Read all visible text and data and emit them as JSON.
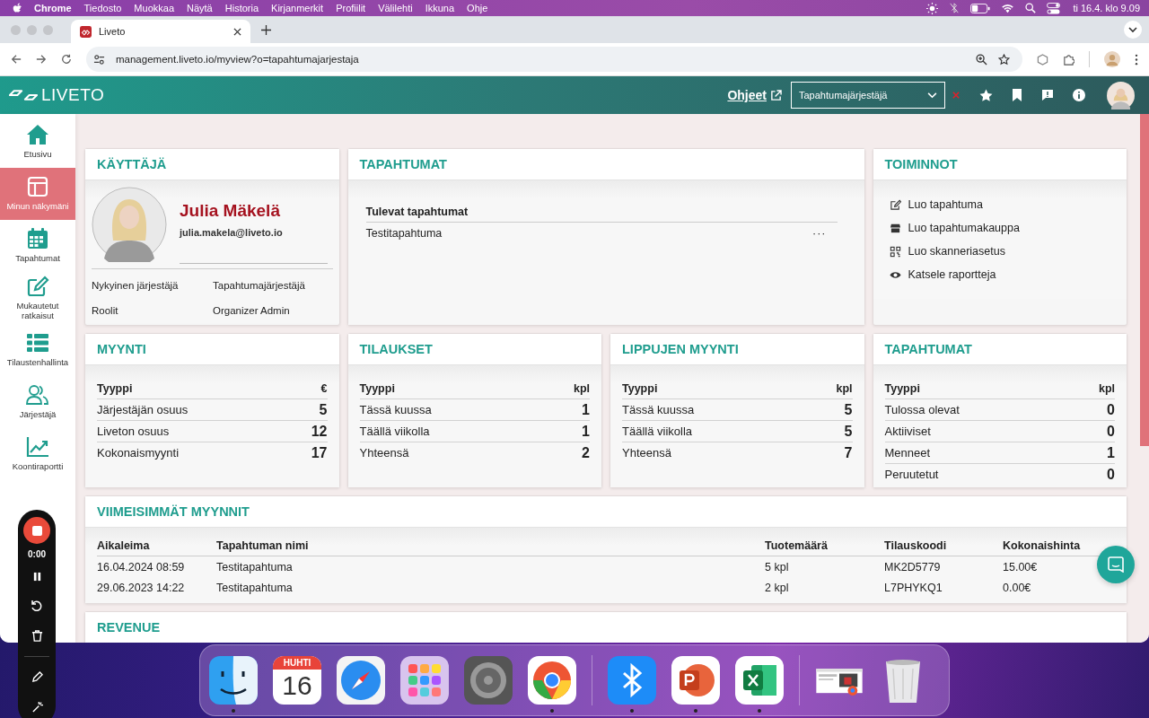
{
  "menubar": {
    "app": "Chrome",
    "menus": [
      "Tiedosto",
      "Muokkaa",
      "Näytä",
      "Historia",
      "Kirjanmerkit",
      "Profiilit",
      "Välilehti",
      "Ikkuna",
      "Ohje"
    ],
    "clock": "ti 16.4. klo 9.09"
  },
  "browser": {
    "tab_title": "Liveto",
    "url": "management.liveto.io/myview?o=tapahtumajarjestaja"
  },
  "header": {
    "logo": "LIVETO",
    "help_link": "Ohjeet",
    "organizer_select": "Tapahtumajärjestäjä"
  },
  "sidebar": {
    "items": [
      {
        "label": "Etusivu",
        "kind": "home",
        "selected": false
      },
      {
        "label": "Minun näkymäni",
        "kind": "layout",
        "selected": true
      },
      {
        "label": "Tapahtumat",
        "kind": "calendar",
        "selected": false
      },
      {
        "label": "Mukautetut ratkaisut",
        "kind": "edit",
        "selected": false
      },
      {
        "label": "Tilaustenhallinta",
        "kind": "list",
        "selected": false
      },
      {
        "label": "Järjestäjä",
        "kind": "users",
        "selected": false
      },
      {
        "label": "Koontiraportti",
        "kind": "chart",
        "selected": false
      }
    ]
  },
  "user_card": {
    "title": "KÄYTTÄJÄ",
    "name": "Julia Mäkelä",
    "email": "julia.makela@liveto.io",
    "fields": [
      {
        "label": "Nykyinen järjestäjä",
        "value": "Tapahtumajärjestäjä"
      },
      {
        "label": "Roolit",
        "value": "Organizer Admin"
      }
    ]
  },
  "events_card": {
    "title": "TAPAHTUMAT",
    "heading": "Tulevat tapahtumat",
    "events": [
      {
        "name": "Testitapahtuma",
        "menu": "···"
      }
    ]
  },
  "actions_card": {
    "title": "TOIMINNOT",
    "actions": [
      {
        "label": "Luo tapahtuma",
        "kind": "edit"
      },
      {
        "label": "Luo tapahtumakauppa",
        "kind": "shop"
      },
      {
        "label": "Luo skanneriasetus",
        "kind": "qr"
      },
      {
        "label": "Katsele raportteja",
        "kind": "eye"
      }
    ]
  },
  "stat_cards": [
    {
      "title": "MYYNTI",
      "columns": [
        "Tyyppi",
        "€"
      ],
      "rows": [
        {
          "label": "Järjestäjän osuus",
          "value": "5"
        },
        {
          "label": "Liveton osuus",
          "value": "12"
        },
        {
          "label": "Kokonaismyynti",
          "value": "17"
        }
      ]
    },
    {
      "title": "TILAUKSET",
      "columns": [
        "Tyyppi",
        "kpl"
      ],
      "rows": [
        {
          "label": "Tässä kuussa",
          "value": "1"
        },
        {
          "label": "Täällä viikolla",
          "value": "1"
        },
        {
          "label": "Yhteensä",
          "value": "2"
        }
      ]
    },
    {
      "title": "LIPPUJEN MYYNTI",
      "columns": [
        "Tyyppi",
        "kpl"
      ],
      "rows": [
        {
          "label": "Tässä kuussa",
          "value": "5"
        },
        {
          "label": "Täällä viikolla",
          "value": "5"
        },
        {
          "label": "Yhteensä",
          "value": "7"
        }
      ]
    },
    {
      "title": "TAPAHTUMAT",
      "columns": [
        "Tyyppi",
        "kpl"
      ],
      "rows": [
        {
          "label": "Tulossa olevat",
          "value": "0"
        },
        {
          "label": "Aktiiviset",
          "value": "0"
        },
        {
          "label": "Menneet",
          "value": "1"
        },
        {
          "label": "Peruutetut",
          "value": "0"
        }
      ]
    }
  ],
  "recent_sales": {
    "title": "VIIMEISIMMÄT MYYNNIT",
    "columns": [
      "Aikaleima",
      "Tapahtuman nimi",
      "Tuotemäärä",
      "Tilauskoodi",
      "Kokonaishinta"
    ],
    "rows": [
      [
        "16.04.2024 08:59",
        "Testitapahtuma",
        "5 kpl",
        "MK2D5779",
        "15.00€"
      ],
      [
        "29.06.2023 14:22",
        "Testitapahtuma",
        "2 kpl",
        "L7PHYKQ1",
        "0.00€"
      ]
    ]
  },
  "revenue": {
    "title": "REVENUE"
  },
  "recorder": {
    "time": "0:00"
  },
  "dock": {
    "items": [
      {
        "kind": "finder",
        "running": true
      },
      {
        "kind": "calendar",
        "month": "HUHTI",
        "day": "16",
        "running": false
      },
      {
        "kind": "safari",
        "running": false
      },
      {
        "kind": "launchpad",
        "running": false
      },
      {
        "kind": "settings",
        "running": false
      },
      {
        "kind": "chrome",
        "running": true
      },
      {
        "kind": "separator"
      },
      {
        "kind": "bluetooth",
        "running": true
      },
      {
        "kind": "powerpoint",
        "running": true
      },
      {
        "kind": "excel",
        "running": true
      },
      {
        "kind": "separator"
      },
      {
        "kind": "window",
        "running": false
      },
      {
        "kind": "trash",
        "running": false
      }
    ]
  }
}
